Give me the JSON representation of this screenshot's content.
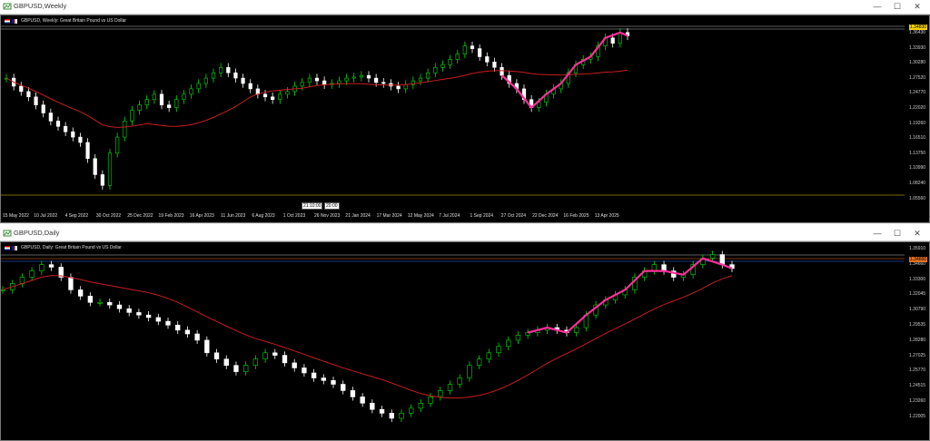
{
  "colors": {
    "background": "#000000",
    "bull": "#00e000",
    "bear": "#ffffff",
    "ma": "#c81e1e",
    "zigzag": "#ff2e9a",
    "bid_tag": "#f4d000",
    "ask_tag": "#e07020",
    "grid_line": "#bcbcbc"
  },
  "weekly": {
    "title": "GBPUSD,Weekly",
    "symbol_label": "GBPUSD, Weekly:  Great Britain Pound vs US Dollar",
    "price_labels": [
      "1.36430",
      "1.33930",
      "1.30280",
      "1.27520",
      "1.24770",
      "1.22020",
      "1.19260",
      "1.16510",
      "1.13750",
      "1.10990",
      "1.08240",
      "1.05560"
    ],
    "current_price": "1.34830",
    "date_labels": [
      "15 May 2022",
      "10 Jul 2022",
      "4 Sep 2022",
      "30 Oct 2022",
      "25 Dec 2022",
      "19 Feb 2023",
      "16 Apr 2023",
      "11 Jun 2023",
      "6 Aug 2023",
      "1 Oct 2023",
      "26 Nov 2023",
      "21 Jan 2024",
      "17 Mar 2024",
      "12 May 2024",
      "7 Jul 2024",
      "1 Sep 2024",
      "27 Oct 2024",
      "22 Dec 2024",
      "16 Feb 2025",
      "13 Apr 2025"
    ],
    "crosshair_labels": [
      "21:10:00",
      "20:00"
    ]
  },
  "daily": {
    "title": "GBPUSD,Daily",
    "symbol_label": "GBPUSD, Daily:  Great Britain Pound vs US Dollar",
    "price_labels": [
      "1.35910",
      "1.34660",
      "1.33300",
      "1.32045",
      "1.30790",
      "1.29535",
      "1.28280",
      "1.27025",
      "1.25770",
      "1.24515",
      "1.23260",
      "1.22005"
    ],
    "current_price": "1.34660"
  },
  "window_buttons": {
    "minimize": "—",
    "maximize": "☐",
    "close": "✕"
  },
  "chart_data": [
    {
      "type": "candlestick",
      "title": "GBPUSD, Weekly:  Great Britain Pound vs US Dollar",
      "series": [
        {
          "values": [
            1.27,
            1.255,
            1.245,
            1.235,
            1.22,
            1.205,
            1.19,
            1.18,
            1.17,
            1.16,
            1.15,
            1.12,
            1.09,
            1.07,
            1.13,
            1.16,
            1.19,
            1.21,
            1.22,
            1.23,
            1.24,
            1.22,
            1.215,
            1.23,
            1.24,
            1.25,
            1.26,
            1.27,
            1.28,
            1.29,
            1.28,
            1.27,
            1.26,
            1.25,
            1.24,
            1.235,
            1.23,
            1.24,
            1.245,
            1.255,
            1.262,
            1.27,
            1.265,
            1.258,
            1.26,
            1.265,
            1.27,
            1.272,
            1.275,
            1.27,
            1.262,
            1.26,
            1.255,
            1.25,
            1.258,
            1.265,
            1.27,
            1.28,
            1.29,
            1.295,
            1.305,
            1.315,
            1.33,
            1.325,
            1.31,
            1.3,
            1.29,
            1.275,
            1.26,
            1.25,
            1.23,
            1.215,
            1.225,
            1.24,
            1.25,
            1.26,
            1.28,
            1.295,
            1.305,
            1.31,
            1.33,
            1.345,
            1.335,
            1.355,
            1.349
          ]
        },
        {
          "name": "MA",
          "values": []
        }
      ]
    },
    {
      "type": "candlestick",
      "title": "GBPUSD, Daily:  Great Britain Pound vs US Dollar",
      "series": [
        {
          "values": [
            1.33,
            1.335,
            1.34,
            1.345,
            1.35,
            1.348,
            1.34,
            1.33,
            1.325,
            1.32,
            1.32,
            1.318,
            1.315,
            1.312,
            1.31,
            1.308,
            1.305,
            1.302,
            1.298,
            1.295,
            1.29,
            1.28,
            1.275,
            1.27,
            1.265,
            1.27,
            1.275,
            1.28,
            1.278,
            1.272,
            1.268,
            1.264,
            1.26,
            1.258,
            1.255,
            1.25,
            1.245,
            1.24,
            1.235,
            1.232,
            1.228,
            1.232,
            1.236,
            1.24,
            1.245,
            1.25,
            1.255,
            1.26,
            1.27,
            1.275,
            1.28,
            1.285,
            1.29,
            1.294,
            1.296,
            1.298,
            1.3,
            1.298,
            1.296,
            1.3,
            1.31,
            1.318,
            1.322,
            1.326,
            1.33,
            1.34,
            1.345,
            1.35,
            1.345,
            1.34,
            1.342,
            1.35,
            1.355,
            1.358,
            1.35,
            1.347
          ]
        },
        {
          "name": "MA",
          "values": []
        }
      ]
    }
  ]
}
